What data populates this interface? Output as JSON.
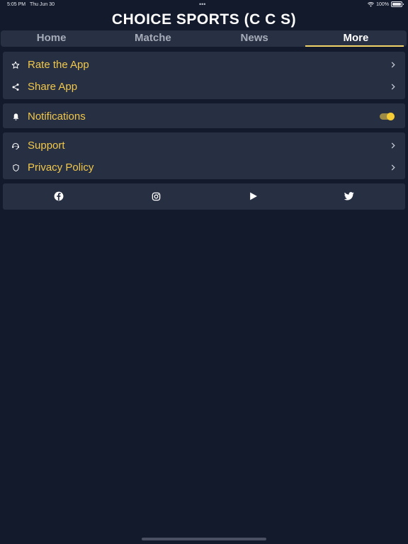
{
  "status_bar": {
    "time": "5:05 PM",
    "date": "Thu Jun 30",
    "battery": "100%"
  },
  "app": {
    "title": "CHOICE SPORTS (C C S)"
  },
  "tabs": [
    {
      "label": "Home",
      "active": false
    },
    {
      "label": "Matche",
      "active": false
    },
    {
      "label": "News",
      "active": false
    },
    {
      "label": "More",
      "active": true
    }
  ],
  "menu": {
    "rate_label": "Rate the App",
    "share_label": "Share App",
    "notifications_label": "Notifications",
    "notifications_enabled": true,
    "support_label": "Support",
    "privacy_label": "Privacy Policy"
  },
  "social": [
    "facebook-icon",
    "instagram-icon",
    "play-icon",
    "twitter-icon"
  ],
  "colors": {
    "background": "#131a2c",
    "card": "#272f42",
    "accent": "#f1c84b",
    "tab_indicator": "#f1d36a"
  }
}
